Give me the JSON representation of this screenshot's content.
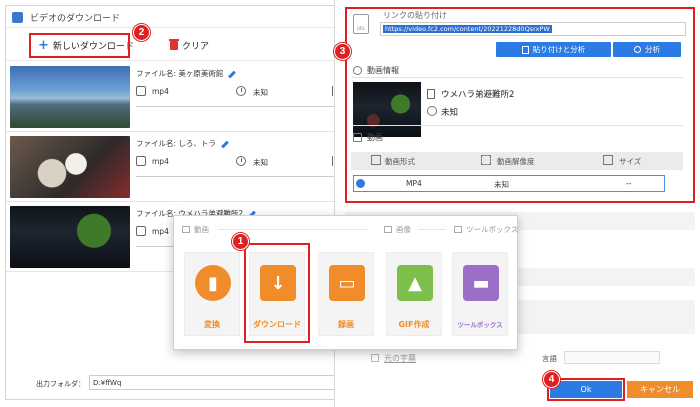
{
  "downloader": {
    "title": "ビデオのダウンロード",
    "new_download_label": "新しいダウンロード",
    "clear_label": "クリア",
    "items": [
      {
        "filename": "ファイル名: 美ヶ原美術館",
        "format": "mp4",
        "duration": "未知"
      },
      {
        "filename": "ファイル名: しろ、トラ",
        "format": "mp4",
        "duration": "未知"
      },
      {
        "filename": "ファイル名: ウメハラ弟避難所2",
        "format": "mp4",
        "duration": "未知"
      }
    ],
    "output_folder_label": "出力フォルダ：",
    "output_folder_value": "D:¥ffWq"
  },
  "dialog": {
    "link_section_title": "リンクの貼り付け",
    "link_icon_text": "URL",
    "url_value": "https://video.fc2.com/content/20221228d0QsrxPW",
    "paste_analyze_label": "貼り付けと分析",
    "analyze_label": "分析",
    "video_info_title": "動画情報",
    "video_title": "ウメハラ弟避難所2",
    "video_duration": "未知",
    "video_section_title": "動画",
    "table_headers": [
      "動画形式",
      "動画解像度",
      "サイズ"
    ],
    "table_rows": [
      {
        "format": "MP4",
        "resolution": "未知",
        "size": "--"
      }
    ],
    "subtitle_label": "元の字幕",
    "language_label": "言語",
    "ok_label": "Ok",
    "cancel_label": "キャンセル"
  },
  "tools_panel": {
    "categories": [
      "動画",
      "画像",
      "ツールボックス"
    ],
    "tiles": [
      {
        "label": "変換",
        "icon": "film-icon",
        "color": "#f08c2a"
      },
      {
        "label": "ダウンロード",
        "icon": "download-icon",
        "color": "#f08c2a"
      },
      {
        "label": "録画",
        "icon": "screen-record-icon",
        "color": "#f08c2a"
      },
      {
        "label": "GIF作成",
        "icon": "gif-image-icon",
        "color": "#7cc04b"
      },
      {
        "label": "ツールボックス",
        "icon": "toolbox-icon",
        "color": "#9b6fc8"
      }
    ]
  },
  "callouts": [
    "1",
    "2",
    "3",
    "4"
  ],
  "colors": {
    "accent_blue": "#2c7be5",
    "highlight_red": "#e02020",
    "orange": "#f08c2a"
  }
}
